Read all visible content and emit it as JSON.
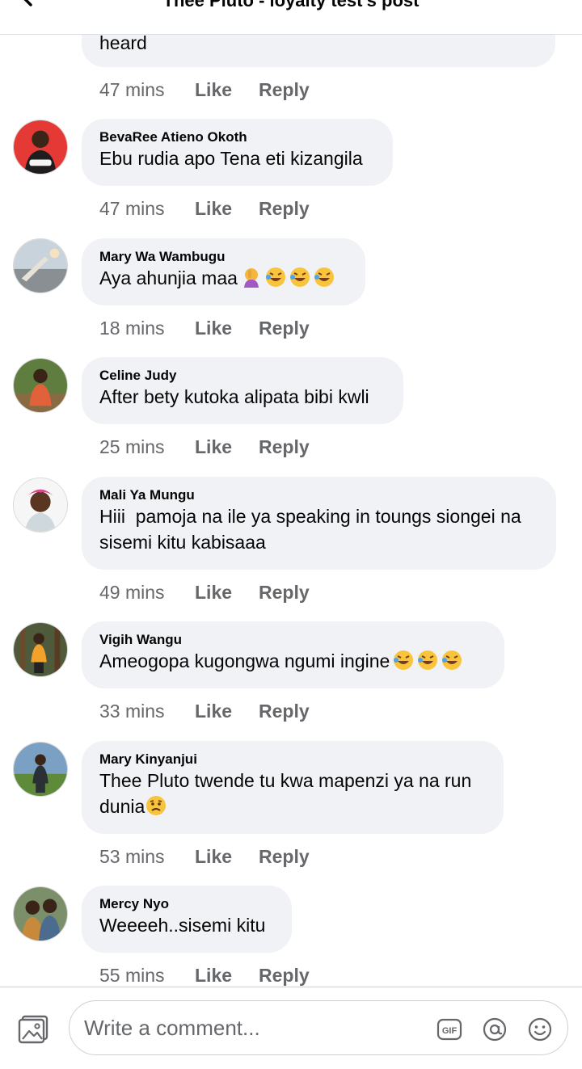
{
  "header": {
    "title": "Thee Pluto - loyalty test's post"
  },
  "comments": [
    {
      "author": "",
      "text": "heard",
      "time": "47 mins"
    },
    {
      "author": "BevaRee Atieno Okoth",
      "text": "Ebu rudia apo Tena eti kizangila",
      "time": "47 mins"
    },
    {
      "author": "Mary Wa Wambugu",
      "text": "Aya ahunjia maa",
      "time": "18 mins"
    },
    {
      "author": "Celine Judy",
      "text": "After bety kutoka alipata bibi kwli",
      "time": "25 mins"
    },
    {
      "author": "Mali Ya Mungu",
      "text": "Hiii  pamoja na ile ya speaking in toungs siongei na sisemi kitu kabisaaa",
      "time": "49 mins"
    },
    {
      "author": "Vigih Wangu",
      "text": "Ameogopa kugongwa ngumi ingine",
      "time": "33 mins"
    },
    {
      "author": "Mary Kinyanjui",
      "text": "Thee Pluto twende tu kwa mapenzi ya na run dunia",
      "time": "53 mins"
    },
    {
      "author": "Mercy Nyo",
      "text": "Weeeeh..sisemi kitu",
      "time": "55 mins"
    }
  ],
  "actions": {
    "like": "Like",
    "reply": "Reply"
  },
  "composer": {
    "placeholder": "Write a comment...",
    "gif": "GIF"
  },
  "colors": {
    "bubble": "#f0f2f5",
    "meta": "#65676b",
    "text": "#050505"
  }
}
